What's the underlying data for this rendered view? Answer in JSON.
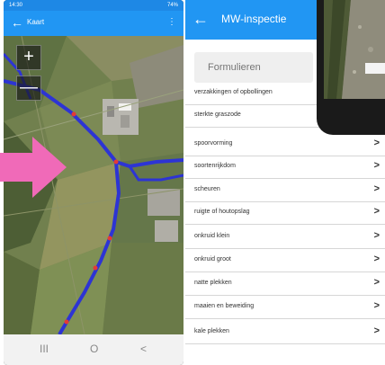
{
  "left_phone": {
    "status_time": "14:30",
    "status_right": "74%",
    "app_title": "Kaart",
    "zoom_in_label": "+",
    "zoom_out_label": "—",
    "nav_recent": "III",
    "nav_home": "O",
    "nav_back": "<"
  },
  "right_phone": {
    "title": "MW-inspectie",
    "form_placeholder": "Formulieren",
    "chevron": ">",
    "items": [
      {
        "label": "verzakkingen of opbollingen",
        "chevron": false
      },
      {
        "label": "sterkte graszode",
        "chevron": false
      },
      {
        "label": "spoorvorming",
        "chevron": true
      },
      {
        "label": "soortenrijkdom",
        "chevron": true
      },
      {
        "label": "scheuren",
        "chevron": true
      },
      {
        "label": "ruigte of houtopslag",
        "chevron": true
      },
      {
        "label": "onkruid klein",
        "chevron": true
      },
      {
        "label": "onkruid groot",
        "chevron": true
      },
      {
        "label": "natte plekken",
        "chevron": true
      },
      {
        "label": "maaien en beweiding",
        "chevron": true
      },
      {
        "label": "kale plekken",
        "chevron": true
      }
    ]
  },
  "colors": {
    "app_blue": "#2196f3",
    "route_blue": "#2d34d4",
    "arrow_pink": "#f06ab8",
    "marker_red": "#e53935"
  },
  "icons": [
    "back-arrow-icon",
    "overflow-menu-icon",
    "chevron-right-icon",
    "zoom-in-icon",
    "zoom-out-icon"
  ]
}
